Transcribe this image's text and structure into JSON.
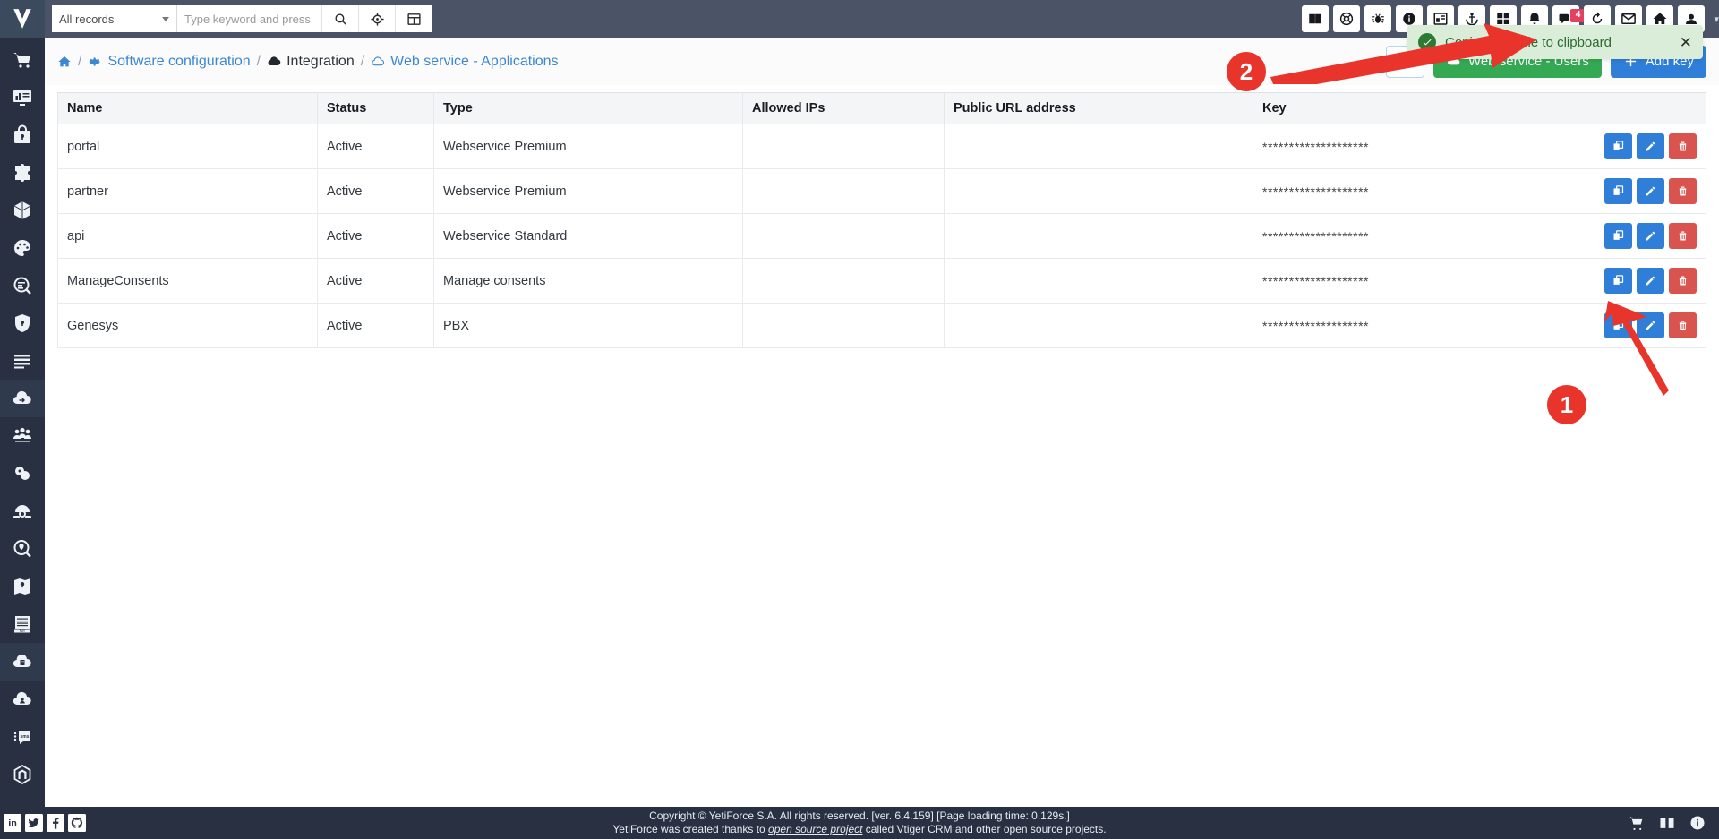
{
  "app": {
    "brand": "YetiForce"
  },
  "topbar": {
    "records_filter": "All records",
    "search_placeholder": "Type keyword and press e",
    "search_value": "",
    "buttons": [
      {
        "name": "search-icon",
        "label": "Search"
      },
      {
        "name": "gps-target-icon",
        "label": "Quick search"
      },
      {
        "name": "grid-modules-icon",
        "label": "Modules"
      }
    ],
    "right_icons": [
      {
        "name": "book-icon",
        "label": "Documentation"
      },
      {
        "name": "lifebuoy-icon",
        "label": "Support"
      },
      {
        "name": "bug-icon",
        "label": "Report bug"
      },
      {
        "name": "info-circle-icon",
        "label": "Info"
      },
      {
        "name": "calendar-widget-icon",
        "label": "Calendar"
      },
      {
        "name": "anchor-icon",
        "label": "Quick create"
      },
      {
        "name": "windows-icon",
        "label": "Widgets"
      },
      {
        "name": "bell-icon",
        "label": "Notifications"
      },
      {
        "name": "chat-icon",
        "label": "Chat",
        "badge": "4"
      },
      {
        "name": "history-icon",
        "label": "History"
      },
      {
        "name": "mail-icon",
        "label": "Mail"
      },
      {
        "name": "home-icon",
        "label": "Home"
      },
      {
        "name": "user-avatar-icon",
        "label": "User menu"
      }
    ],
    "caret": "▾"
  },
  "breadcrumb": {
    "items": [
      {
        "icon": "home-icon",
        "label": "",
        "link": true
      },
      {
        "icon": "gear-icon",
        "label": "Software configuration",
        "link": true
      },
      {
        "icon": "integration-icon",
        "label": "Integration",
        "link": false
      },
      {
        "icon": "cloud-icon",
        "label": "Web service - Applications",
        "link": true
      }
    ],
    "separator": "/"
  },
  "header_actions": {
    "bookmark_label": "",
    "webservice_users_label": "Web service - Users",
    "add_key_label": "Add key"
  },
  "table": {
    "columns": [
      "Name",
      "Status",
      "Type",
      "Allowed IPs",
      "Public URL address",
      "Key"
    ],
    "rows": [
      {
        "name": "portal",
        "status": "Active",
        "type": "Webservice Premium",
        "ips": "",
        "url": "",
        "key": "********************"
      },
      {
        "name": "partner",
        "status": "Active",
        "type": "Webservice Premium",
        "ips": "",
        "url": "",
        "key": "********************"
      },
      {
        "name": "api",
        "status": "Active",
        "type": "Webservice Standard",
        "ips": "",
        "url": "",
        "key": "********************"
      },
      {
        "name": "ManageConsents",
        "status": "Active",
        "type": "Manage consents",
        "ips": "",
        "url": "",
        "key": "********************"
      },
      {
        "name": "Genesys",
        "status": "Active",
        "type": "PBX",
        "ips": "",
        "url": "",
        "key": "********************"
      }
    ],
    "row_actions": [
      {
        "name": "copy-key-button",
        "icon": "copy-icon"
      },
      {
        "name": "edit-record-button",
        "icon": "pencil-icon"
      },
      {
        "name": "delete-record-button",
        "icon": "trash-icon"
      }
    ]
  },
  "toast": {
    "message": "Copied variable to clipboard",
    "close_label": "✕",
    "bg_color": "#d9edd9",
    "text_color": "#2c6b30",
    "icon_color": "#2d7a33"
  },
  "annotations": [
    {
      "number": "1",
      "target": "copy-key-button-row-5"
    },
    {
      "number": "2",
      "target": "toast-notification"
    }
  ],
  "footer": {
    "line1": "Copyright © YetiForce S.A. All rights reserved. [ver. 6.4.159] [Page loading time: 0.129s.]",
    "line2_pre": "YetiForce was created thanks to ",
    "line2_link": "open source project",
    "line2_post": " called Vtiger CRM and other open source projects.",
    "right_icons": [
      {
        "name": "cart-icon"
      },
      {
        "name": "book-icon"
      },
      {
        "name": "info-circle-icon"
      }
    ]
  },
  "sidebar": {
    "items": [
      {
        "name": "sidebar-item-cart",
        "icon": "cart-icon"
      },
      {
        "name": "sidebar-item-dashboard",
        "icon": "dashboard-icon"
      },
      {
        "name": "sidebar-item-security",
        "icon": "lock-briefcase-icon"
      },
      {
        "name": "sidebar-item-modules",
        "icon": "puzzle-icon"
      },
      {
        "name": "sidebar-item-blocks",
        "icon": "cube-icon"
      },
      {
        "name": "sidebar-item-appearance",
        "icon": "palette-icon"
      },
      {
        "name": "sidebar-item-search",
        "icon": "doc-search-icon"
      },
      {
        "name": "sidebar-item-permissions",
        "icon": "shield-lock-icon"
      },
      {
        "name": "sidebar-item-logs",
        "icon": "list-icon"
      },
      {
        "name": "sidebar-item-integration",
        "icon": "cloud-exchange-icon"
      },
      {
        "name": "sidebar-item-users",
        "icon": "users-icon"
      },
      {
        "name": "sidebar-item-tags",
        "icon": "tags-icon"
      },
      {
        "name": "sidebar-item-pbx",
        "icon": "phone-icon"
      },
      {
        "name": "sidebar-item-map-search",
        "icon": "location-search-icon"
      },
      {
        "name": "sidebar-item-map",
        "icon": "map-icon"
      },
      {
        "name": "sidebar-item-payments",
        "icon": "invoice-icon"
      },
      {
        "name": "sidebar-item-companies",
        "icon": "cloud-building-icon"
      },
      {
        "name": "sidebar-item-portal",
        "icon": "cloud-user-icon"
      },
      {
        "name": "sidebar-item-sms",
        "icon": "sms-icon"
      },
      {
        "name": "sidebar-item-magento",
        "icon": "magento-icon"
      }
    ],
    "social": [
      {
        "name": "linkedin-icon"
      },
      {
        "name": "twitter-icon"
      },
      {
        "name": "facebook-icon"
      },
      {
        "name": "github-icon"
      }
    ]
  }
}
